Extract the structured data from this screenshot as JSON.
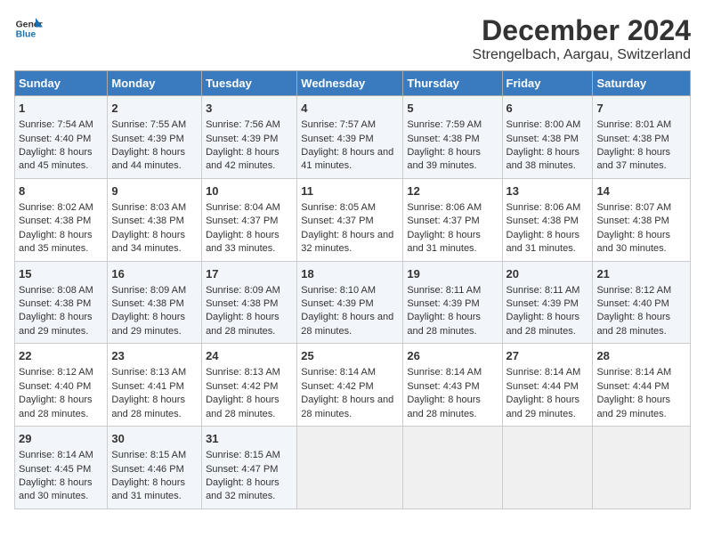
{
  "logo": {
    "line1": "General",
    "line2": "Blue"
  },
  "title": "December 2024",
  "subtitle": "Strengelbach, Aargau, Switzerland",
  "header_days": [
    "Sunday",
    "Monday",
    "Tuesday",
    "Wednesday",
    "Thursday",
    "Friday",
    "Saturday"
  ],
  "weeks": [
    [
      {
        "day": "1",
        "sunrise": "Sunrise: 7:54 AM",
        "sunset": "Sunset: 4:40 PM",
        "daylight": "Daylight: 8 hours and 45 minutes."
      },
      {
        "day": "2",
        "sunrise": "Sunrise: 7:55 AM",
        "sunset": "Sunset: 4:39 PM",
        "daylight": "Daylight: 8 hours and 44 minutes."
      },
      {
        "day": "3",
        "sunrise": "Sunrise: 7:56 AM",
        "sunset": "Sunset: 4:39 PM",
        "daylight": "Daylight: 8 hours and 42 minutes."
      },
      {
        "day": "4",
        "sunrise": "Sunrise: 7:57 AM",
        "sunset": "Sunset: 4:39 PM",
        "daylight": "Daylight: 8 hours and 41 minutes."
      },
      {
        "day": "5",
        "sunrise": "Sunrise: 7:59 AM",
        "sunset": "Sunset: 4:38 PM",
        "daylight": "Daylight: 8 hours and 39 minutes."
      },
      {
        "day": "6",
        "sunrise": "Sunrise: 8:00 AM",
        "sunset": "Sunset: 4:38 PM",
        "daylight": "Daylight: 8 hours and 38 minutes."
      },
      {
        "day": "7",
        "sunrise": "Sunrise: 8:01 AM",
        "sunset": "Sunset: 4:38 PM",
        "daylight": "Daylight: 8 hours and 37 minutes."
      }
    ],
    [
      {
        "day": "8",
        "sunrise": "Sunrise: 8:02 AM",
        "sunset": "Sunset: 4:38 PM",
        "daylight": "Daylight: 8 hours and 35 minutes."
      },
      {
        "day": "9",
        "sunrise": "Sunrise: 8:03 AM",
        "sunset": "Sunset: 4:38 PM",
        "daylight": "Daylight: 8 hours and 34 minutes."
      },
      {
        "day": "10",
        "sunrise": "Sunrise: 8:04 AM",
        "sunset": "Sunset: 4:37 PM",
        "daylight": "Daylight: 8 hours and 33 minutes."
      },
      {
        "day": "11",
        "sunrise": "Sunrise: 8:05 AM",
        "sunset": "Sunset: 4:37 PM",
        "daylight": "Daylight: 8 hours and 32 minutes."
      },
      {
        "day": "12",
        "sunrise": "Sunrise: 8:06 AM",
        "sunset": "Sunset: 4:37 PM",
        "daylight": "Daylight: 8 hours and 31 minutes."
      },
      {
        "day": "13",
        "sunrise": "Sunrise: 8:06 AM",
        "sunset": "Sunset: 4:38 PM",
        "daylight": "Daylight: 8 hours and 31 minutes."
      },
      {
        "day": "14",
        "sunrise": "Sunrise: 8:07 AM",
        "sunset": "Sunset: 4:38 PM",
        "daylight": "Daylight: 8 hours and 30 minutes."
      }
    ],
    [
      {
        "day": "15",
        "sunrise": "Sunrise: 8:08 AM",
        "sunset": "Sunset: 4:38 PM",
        "daylight": "Daylight: 8 hours and 29 minutes."
      },
      {
        "day": "16",
        "sunrise": "Sunrise: 8:09 AM",
        "sunset": "Sunset: 4:38 PM",
        "daylight": "Daylight: 8 hours and 29 minutes."
      },
      {
        "day": "17",
        "sunrise": "Sunrise: 8:09 AM",
        "sunset": "Sunset: 4:38 PM",
        "daylight": "Daylight: 8 hours and 28 minutes."
      },
      {
        "day": "18",
        "sunrise": "Sunrise: 8:10 AM",
        "sunset": "Sunset: 4:39 PM",
        "daylight": "Daylight: 8 hours and 28 minutes."
      },
      {
        "day": "19",
        "sunrise": "Sunrise: 8:11 AM",
        "sunset": "Sunset: 4:39 PM",
        "daylight": "Daylight: 8 hours and 28 minutes."
      },
      {
        "day": "20",
        "sunrise": "Sunrise: 8:11 AM",
        "sunset": "Sunset: 4:39 PM",
        "daylight": "Daylight: 8 hours and 28 minutes."
      },
      {
        "day": "21",
        "sunrise": "Sunrise: 8:12 AM",
        "sunset": "Sunset: 4:40 PM",
        "daylight": "Daylight: 8 hours and 28 minutes."
      }
    ],
    [
      {
        "day": "22",
        "sunrise": "Sunrise: 8:12 AM",
        "sunset": "Sunset: 4:40 PM",
        "daylight": "Daylight: 8 hours and 28 minutes."
      },
      {
        "day": "23",
        "sunrise": "Sunrise: 8:13 AM",
        "sunset": "Sunset: 4:41 PM",
        "daylight": "Daylight: 8 hours and 28 minutes."
      },
      {
        "day": "24",
        "sunrise": "Sunrise: 8:13 AM",
        "sunset": "Sunset: 4:42 PM",
        "daylight": "Daylight: 8 hours and 28 minutes."
      },
      {
        "day": "25",
        "sunrise": "Sunrise: 8:14 AM",
        "sunset": "Sunset: 4:42 PM",
        "daylight": "Daylight: 8 hours and 28 minutes."
      },
      {
        "day": "26",
        "sunrise": "Sunrise: 8:14 AM",
        "sunset": "Sunset: 4:43 PM",
        "daylight": "Daylight: 8 hours and 28 minutes."
      },
      {
        "day": "27",
        "sunrise": "Sunrise: 8:14 AM",
        "sunset": "Sunset: 4:44 PM",
        "daylight": "Daylight: 8 hours and 29 minutes."
      },
      {
        "day": "28",
        "sunrise": "Sunrise: 8:14 AM",
        "sunset": "Sunset: 4:44 PM",
        "daylight": "Daylight: 8 hours and 29 minutes."
      }
    ],
    [
      {
        "day": "29",
        "sunrise": "Sunrise: 8:14 AM",
        "sunset": "Sunset: 4:45 PM",
        "daylight": "Daylight: 8 hours and 30 minutes."
      },
      {
        "day": "30",
        "sunrise": "Sunrise: 8:15 AM",
        "sunset": "Sunset: 4:46 PM",
        "daylight": "Daylight: 8 hours and 31 minutes."
      },
      {
        "day": "31",
        "sunrise": "Sunrise: 8:15 AM",
        "sunset": "Sunset: 4:47 PM",
        "daylight": "Daylight: 8 hours and 32 minutes."
      },
      null,
      null,
      null,
      null
    ]
  ]
}
